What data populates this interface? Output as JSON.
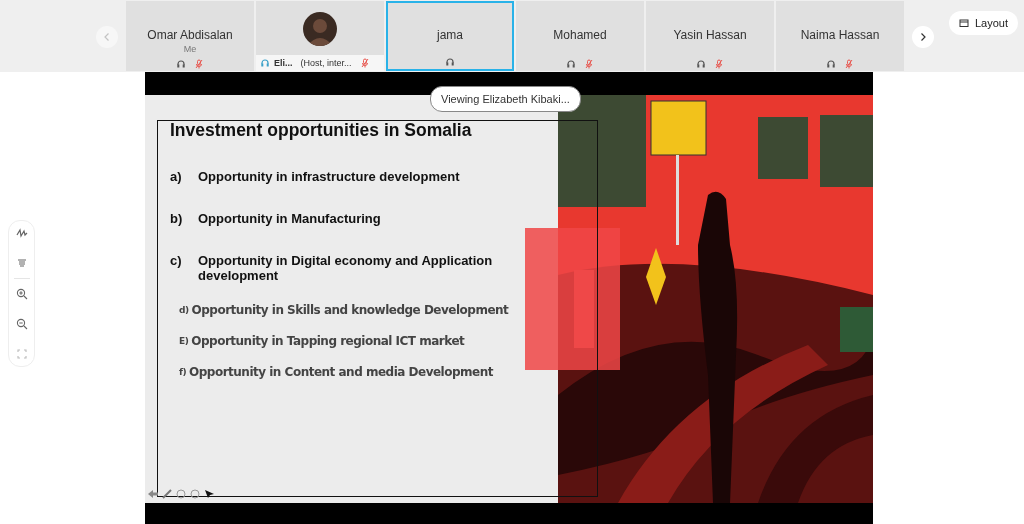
{
  "participants": [
    {
      "kind": "name",
      "name": "Omar Abdisalan",
      "note": "Me",
      "selected": false,
      "muted": true
    },
    {
      "kind": "avatar",
      "name": "Eli...",
      "note": "(Host, inter...",
      "selected": false,
      "muted": true
    },
    {
      "kind": "name",
      "name": "jama",
      "selected": true,
      "muted": false
    },
    {
      "kind": "name",
      "name": "Mohamed",
      "selected": false,
      "muted": true
    },
    {
      "kind": "name",
      "name": "Yasin Hassan",
      "selected": false,
      "muted": true
    },
    {
      "kind": "name",
      "name": "Naima Hassan",
      "selected": false,
      "muted": true
    }
  ],
  "layout_button": {
    "label": "Layout"
  },
  "share": {
    "viewing": "Viewing Elizabeth Kibaki...",
    "slide": {
      "title": "Investment opportunities in Somalia",
      "items": [
        {
          "kind": "primary",
          "marker": "a)",
          "text": "Opportunity in infrastructure development"
        },
        {
          "kind": "primary",
          "marker": "b)",
          "text": "Opportunity in Manufacturing"
        },
        {
          "kind": "primary",
          "marker": "c)",
          "text": "Opportunity in Digital economy and Application development"
        },
        {
          "kind": "secondary",
          "marker": "d)",
          "text": "Opportunity in Skills and knowledge Development"
        },
        {
          "kind": "secondary",
          "marker": "E)",
          "text": "Opportunity in  Tapping regional ICT  market"
        },
        {
          "kind": "secondary",
          "marker": "f)",
          "text": "Opportunity in Content  and media Development"
        }
      ]
    }
  }
}
